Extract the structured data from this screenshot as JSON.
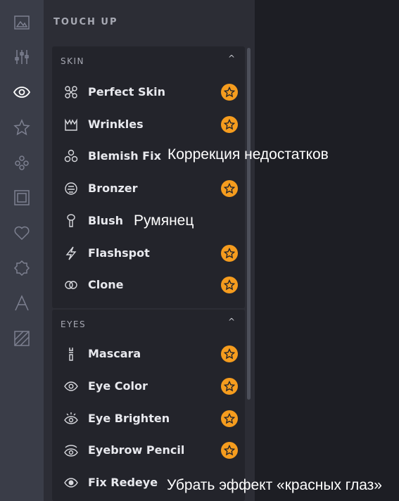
{
  "rail": {
    "icons": [
      "image-icon",
      "sliders-icon",
      "eye-icon",
      "star-icon",
      "effects-icon",
      "frame-icon",
      "heart-icon",
      "badge-icon",
      "text-icon",
      "texture-icon"
    ]
  },
  "panel": {
    "title": "TOUCH UP",
    "sections": [
      {
        "header": "SKIN",
        "chevron": "^",
        "items": [
          {
            "label": "Perfect Skin",
            "icon": "sparkle-icon",
            "premium": true
          },
          {
            "label": "Wrinkles",
            "icon": "wrinkles-icon",
            "premium": true
          },
          {
            "label": "Blemish Fix",
            "icon": "blemish-icon",
            "premium": false
          },
          {
            "label": "Bronzer",
            "icon": "bronzer-icon",
            "premium": true
          },
          {
            "label": "Blush",
            "icon": "blush-brush-icon",
            "premium": false
          },
          {
            "label": "Flashspot",
            "icon": "lightning-icon",
            "premium": true
          },
          {
            "label": "Clone",
            "icon": "clone-rings-icon",
            "premium": true
          }
        ]
      },
      {
        "header": "EYES",
        "chevron": "^",
        "items": [
          {
            "label": "Mascara",
            "icon": "mascara-icon",
            "premium": true
          },
          {
            "label": "Eye Color",
            "icon": "eye-icon",
            "premium": true
          },
          {
            "label": "Eye Brighten",
            "icon": "eye-brighten-icon",
            "premium": true
          },
          {
            "label": "Eyebrow Pencil",
            "icon": "eyebrow-icon",
            "premium": true
          },
          {
            "label": "Fix Redeye",
            "icon": "eye-icon",
            "premium": false
          }
        ]
      }
    ]
  },
  "annotations": {
    "blemish": "Коррекция недостатков",
    "blush": "Румянец",
    "redeye": "Убрать эффект «красных глаз»"
  },
  "colors": {
    "rail_bg": "#3a3d48",
    "panel_bg": "#2c2d35",
    "section_bg": "#23242b",
    "workspace_bg": "#1d1e24",
    "premium_star": "#f59c1e"
  }
}
